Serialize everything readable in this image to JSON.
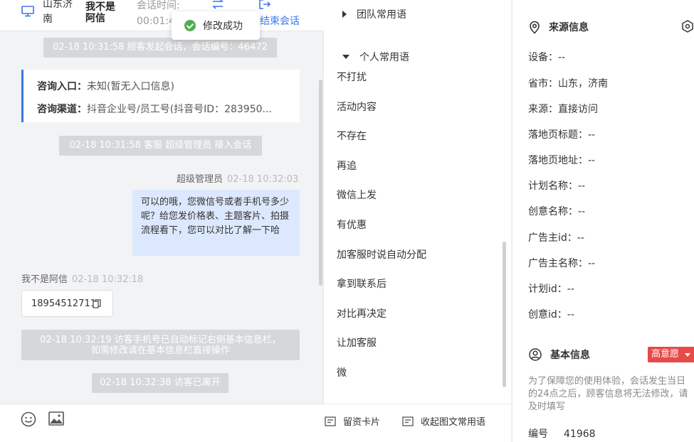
{
  "header": {
    "location": "山东济南",
    "visitor_name": "我不是阿信",
    "session_time_label": "会话时间:",
    "session_time_value": "00:01:4",
    "end_session_label": "结束会话"
  },
  "toast": {
    "message": "修改成功"
  },
  "messages": {
    "sys_start": "02-18 10:31:58 顾客发起会话，会话编号：46472",
    "inquiry_entry_label": "咨询入口：",
    "inquiry_entry_value": "未知(暂无入口信息)",
    "inquiry_channel_label": "咨询渠道：",
    "inquiry_channel_value": "抖音企业号/员工号(抖音号ID：283950...",
    "sys_join": "02-18 10:31:58 客服 超级管理员 接入会话",
    "agent_name": "超级管理员",
    "agent_time": "02-18 10:32:03",
    "agent_text": "可以的哦，您微信号或者手机号多少呢？给您发价格表、主题客片、拍摄流程看下，您可以对比了解一下哈",
    "visitor_name": "我不是阿信",
    "visitor_time": "02-18 10:32:18",
    "visitor_text": "18954512711",
    "sys_phone_line1": "02-18 10:32:19 访客手机号已自动标记右侧基本信息栏，",
    "sys_phone_line2": "如需修改请在基本信息栏直接操作",
    "sys_left": "02-18 10:32:38 访客已离开"
  },
  "phrases": {
    "team_group": "团队常用语",
    "personal_group": "个人常用语",
    "items": [
      "不打扰",
      "活动内容",
      "不存在",
      "再追",
      "微信上发",
      "有优惠",
      "加客服时说自动分配",
      "拿到联系后",
      "对比再决定",
      "让加客服",
      "微"
    ],
    "footer_card": "留资卡片",
    "footer_collapse": "收起图文常用语"
  },
  "source": {
    "title": "来源信息",
    "fields": [
      "设备：--",
      "省市：山东，济南",
      "来源：直接访问",
      "落地页标题：--",
      "落地页地址：--",
      "计划名称：--",
      "创意名称：--",
      "广告主id：--",
      "广告主名称：--",
      "计划id：--",
      "创意id：--"
    ]
  },
  "basic": {
    "title": "基本信息",
    "intent_badge": "高意愿",
    "notice": "为了保障您的使用体验，会话发生当日的24点之后，顾客信息将无法修改，请及时填写",
    "id_label": "编号",
    "id_value": "41968"
  },
  "colors": {
    "accent": "#3a78e6",
    "agent_bubble": "#dce8fd",
    "badge": "#e84a4a",
    "success": "#4caf50"
  }
}
